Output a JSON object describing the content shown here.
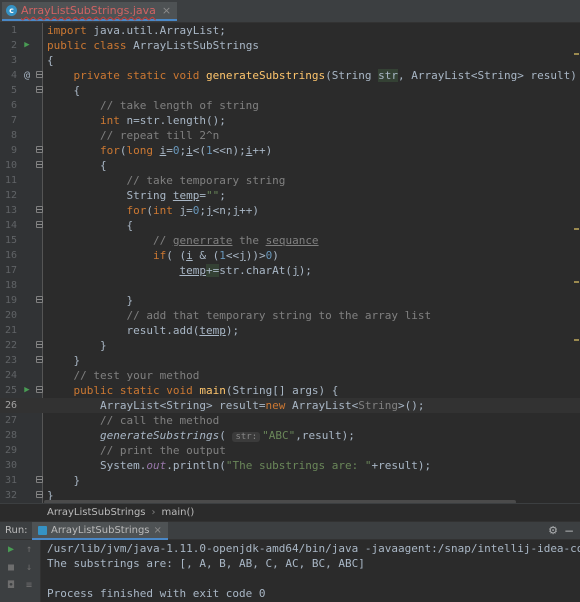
{
  "editor_tab": {
    "icon_letter": "c",
    "file_name": "ArrayListSubStrings.java",
    "close": "×"
  },
  "gutter": {
    "line_numbers": [
      "1",
      "2",
      "3",
      "4",
      "5",
      "6",
      "7",
      "8",
      "9",
      "10",
      "11",
      "12",
      "13",
      "14",
      "15",
      "16",
      "17",
      "18",
      "19",
      "20",
      "21",
      "22",
      "23",
      "24",
      "25",
      "26",
      "27",
      "28",
      "29",
      "30",
      "31",
      "32"
    ],
    "at_mark": "@"
  },
  "breadcrumb": {
    "class_name": "ArrayListSubStrings",
    "separator": "›",
    "method_name": "main()"
  },
  "run_panel": {
    "label": "Run:",
    "tab_title": "ArrayListSubStrings",
    "tab_close": "×",
    "gear_icon": "⚙",
    "hide_icon": "−",
    "output_lines": [
      "/usr/lib/jvm/java-1.11.0-openjdk-amd64/bin/java -javaagent:/snap/intellij-idea-co",
      "The substrings are: [, A, B, AB, C, AC, BC, ABC]",
      "",
      "Process finished with exit code 0"
    ]
  },
  "colors": {
    "keyword": "#cc7832",
    "comment": "#808080",
    "string": "#6a8759",
    "number": "#6897bb",
    "method": "#ffc66d",
    "run_green": "#499c54",
    "accent": "#4a88c7"
  }
}
